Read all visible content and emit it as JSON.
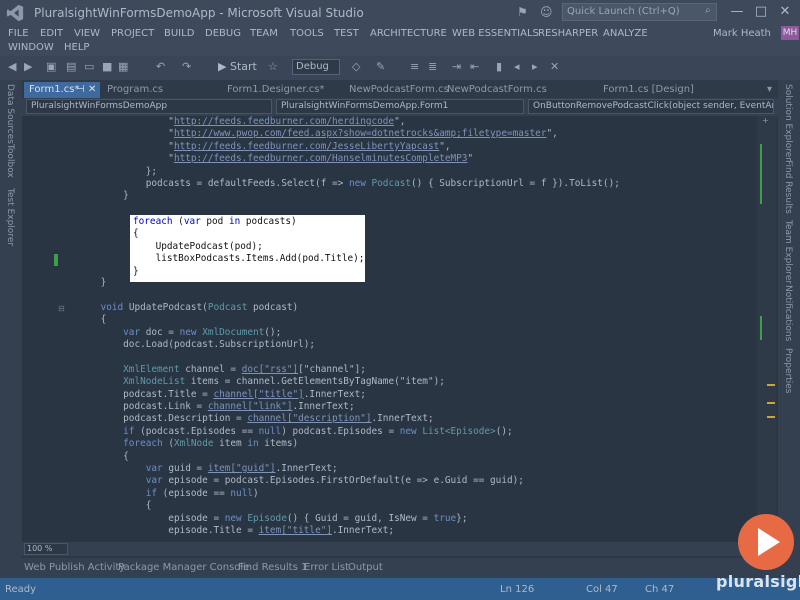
{
  "window": {
    "title": "PluralsightWinFormsDemoApp - Microsoft Visual Studio",
    "quick_launch_placeholder": "Quick Launch (Ctrl+Q)",
    "minimize": "—",
    "maximize": "□",
    "close": "✕"
  },
  "menu": {
    "items": [
      "FILE",
      "EDIT",
      "VIEW",
      "PROJECT",
      "BUILD",
      "DEBUG",
      "TEAM",
      "TOOLS",
      "TEST",
      "ARCHITECTURE",
      "WEB ESSENTIALS",
      "RESHARPER",
      "ANALYZE",
      "WINDOW",
      "HELP"
    ],
    "user": "Mark Heath",
    "avatar": "MH"
  },
  "toolbar": {
    "start_label": "▶ Start",
    "config": "Debug"
  },
  "tabs": [
    {
      "label": "Form1.cs*",
      "active": true
    },
    {
      "label": "Program.cs",
      "active": false
    },
    {
      "label": "Form1.Designer.cs*",
      "active": false
    },
    {
      "label": "NewPodcastForm.cs",
      "active": false
    },
    {
      "label": "NewPodcastForm.cs [Design]",
      "active": false
    },
    {
      "label": "Form1.cs [Design]",
      "active": false
    }
  ],
  "nav": {
    "project": "PluralsightWinFormsDemoApp",
    "class": "PluralsightWinFormsDemoApp.Form1",
    "member": "OnButtonRemovePodcastClick(object sender, EventAr"
  },
  "left_tabs": [
    "Data Sources",
    "Toolbox",
    "Test Explorer"
  ],
  "right_tabs": [
    "Solution Explorer",
    "Find Results",
    "Team Explorer",
    "Notifications",
    "Properties"
  ],
  "code_lines": [
    [
      "                \"",
      {
        "u": "http://feeds.feedburner.com/herdingcode"
      },
      "\","
    ],
    [
      "                \"",
      {
        "u": "http://www.pwop.com/feed.aspx?show=dotnetrocks&amp;filetype=master"
      },
      "\","
    ],
    [
      "                \"",
      {
        "u": "http://feeds.feedburner.com/JesseLibertyYapcast"
      },
      "\","
    ],
    [
      "                \"",
      {
        "u": "http://feeds.feedburner.com/HanselminutesCompleteMP3"
      },
      "\""
    ],
    [
      "            };"
    ],
    [
      "            podcasts = defaultFeeds.Select(f => ",
      {
        "k": "new "
      },
      {
        "t": "Podcast"
      },
      "() { SubscriptionUrl = f }).ToList();"
    ],
    [
      "        }"
    ],
    [
      ""
    ],
    [
      ""
    ],
    [
      ""
    ],
    [
      ""
    ],
    [
      ""
    ],
    [
      ""
    ],
    [
      "    }"
    ],
    [
      ""
    ],
    [
      "    ",
      {
        "k": "void "
      },
      "UpdatePodcast(",
      {
        "t": "Podcast"
      },
      " podcast)"
    ],
    [
      "    {"
    ],
    [
      "        ",
      {
        "k": "var "
      },
      "doc = ",
      {
        "k": "new "
      },
      {
        "t": "XmlDocument"
      },
      "();"
    ],
    [
      "        doc.Load(podcast.SubscriptionUrl);"
    ],
    [
      ""
    ],
    [
      "        ",
      {
        "t": "XmlElement"
      },
      " channel = ",
      {
        "u": "doc[\"rss\"]"
      },
      "[\"channel\"];"
    ],
    [
      "        ",
      {
        "t": "XmlNodeList"
      },
      " items = channel.GetElementsByTagName(\"item\");"
    ],
    [
      "        podcast.Title = ",
      {
        "u": "channel[\"title\"]"
      },
      ".InnerText;"
    ],
    [
      "        podcast.Link = ",
      {
        "u": "channel[\"link\"]"
      },
      ".InnerText;"
    ],
    [
      "        podcast.Description = ",
      {
        "u": "channel[\"description\"]"
      },
      ".InnerText;"
    ],
    [
      "        ",
      {
        "k": "if "
      },
      "(podcast.Episodes == ",
      {
        "k": "null"
      },
      ") podcast.Episodes = ",
      {
        "k": "new "
      },
      {
        "t": "List<Episode>"
      },
      "();"
    ],
    [
      "        ",
      {
        "k": "foreach "
      },
      "(",
      {
        "t": "XmlNode"
      },
      " item ",
      {
        "k": "in "
      },
      "items)"
    ],
    [
      "        {"
    ],
    [
      "            ",
      {
        "k": "var "
      },
      "guid = ",
      {
        "u": "item[\"guid\"]"
      },
      ".InnerText;"
    ],
    [
      "            ",
      {
        "k": "var "
      },
      "episode = podcast.Episodes.FirstOrDefault(e => e.Guid == guid);"
    ],
    [
      "            ",
      {
        "k": "if "
      },
      "(episode == ",
      {
        "k": "null"
      },
      ")"
    ],
    [
      "            {"
    ],
    [
      "                episode = ",
      {
        "k": "new "
      },
      {
        "t": "Episode"
      },
      "() { Guid = guid, IsNew = ",
      {
        "k": "true"
      },
      "};"
    ],
    [
      "                episode.Title = ",
      {
        "u": "item[\"title\"]"
      },
      ".InnerText;"
    ]
  ],
  "highlight_lines": [
    [
      {
        "k": "foreach "
      },
      "(",
      {
        "k": "var "
      },
      "pod ",
      {
        "k": "in "
      },
      "podcasts)"
    ],
    [
      "{"
    ],
    [
      "    UpdatePodcast(pod);"
    ],
    [
      "    listBoxPodcasts.Items.Add(pod.Title);"
    ],
    [
      "}"
    ]
  ],
  "editor": {
    "zoom": "100 %"
  },
  "bottom_tabs": [
    "Web Publish Activity",
    "Package Manager Console",
    "Find Results 1",
    "Error List",
    "Output"
  ],
  "status": {
    "ready": "Ready",
    "ln": "Ln 126",
    "col": "Col 47",
    "ch": "Ch 47"
  },
  "brand": {
    "name": "pluralsight",
    "accent": "#e76a44",
    "status_color": "#2e5f90"
  }
}
